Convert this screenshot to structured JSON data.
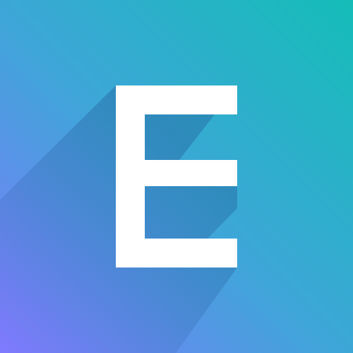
{
  "app_icon": {
    "name": "letter-e-app-icon",
    "letter": "E",
    "colors": {
      "gradient_top_right": "#14bdb8",
      "gradient_middle": "#3ea6d8",
      "gradient_bottom_left": "#8179ff",
      "letter": "#ffffff",
      "long_shadow": "#1e4f8f"
    }
  }
}
